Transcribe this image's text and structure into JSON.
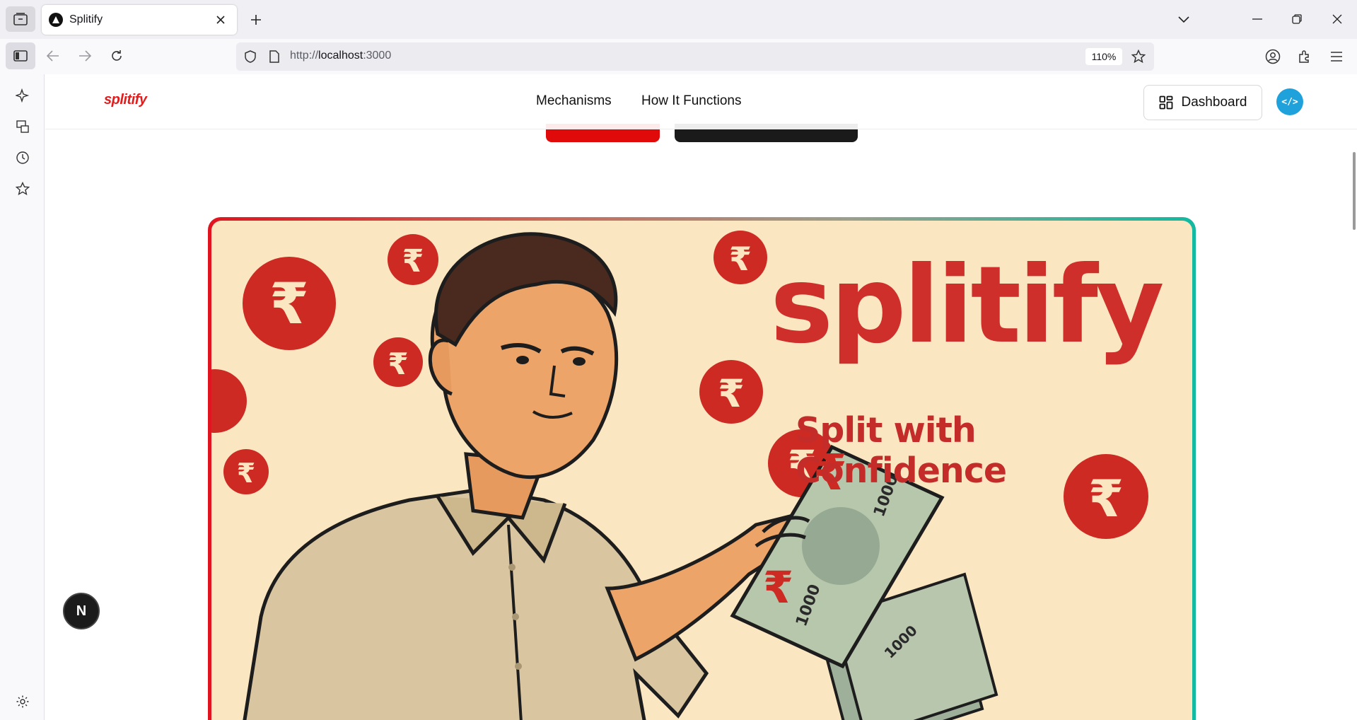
{
  "browser": {
    "tab": {
      "title": "Splitify"
    },
    "url": {
      "scheme": "http://",
      "host": "localhost",
      "port": ":3000"
    },
    "zoom": "110%"
  },
  "header": {
    "logo": "splitify",
    "nav": [
      "Mechanisms",
      "How It Functions"
    ],
    "dashboard_label": "Dashboard",
    "avatar_text": "</>"
  },
  "hero": {
    "title": "splitify",
    "tagline": "Split with Confidence",
    "note_denomination": "1000",
    "coin_symbol": "₹"
  },
  "next_badge": "N",
  "colors": {
    "brand_red": "#e11d1d",
    "hero_bg": "#fbe6c2",
    "frame_start": "#e0141f",
    "frame_end": "#12b9a0",
    "avatar_bg": "#1fa1dc"
  }
}
